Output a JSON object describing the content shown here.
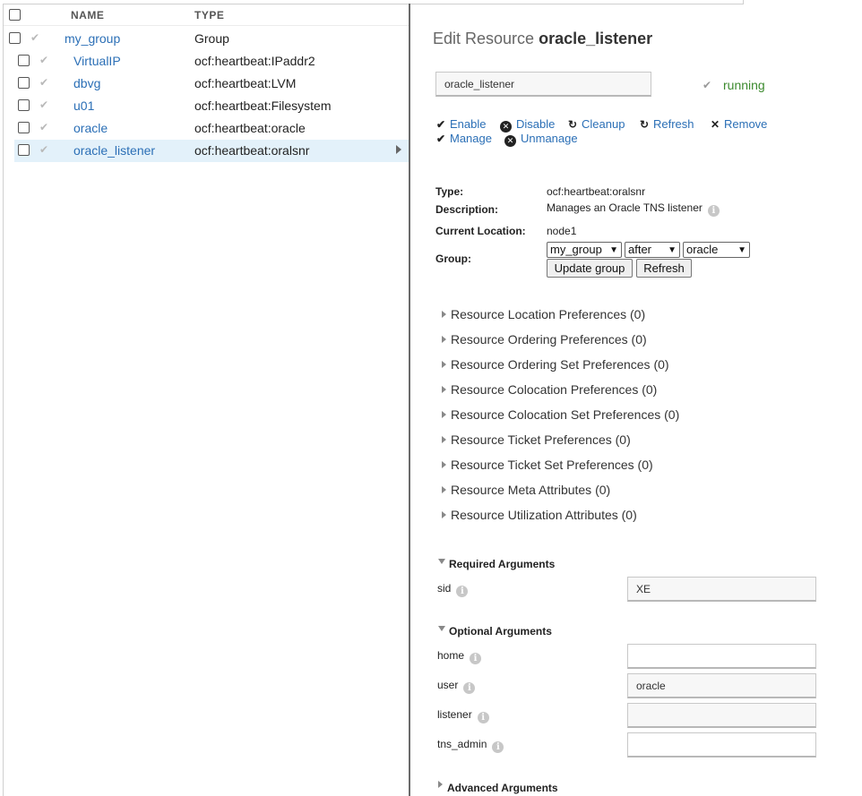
{
  "table": {
    "col_name": "NAME",
    "col_type": "TYPE",
    "rows": [
      {
        "name": "my_group",
        "type": "Group"
      },
      {
        "name": "VirtualIP",
        "type": "ocf:heartbeat:IPaddr2"
      },
      {
        "name": "dbvg",
        "type": "ocf:heartbeat:LVM"
      },
      {
        "name": "u01",
        "type": "ocf:heartbeat:Filesystem"
      },
      {
        "name": "oracle",
        "type": "ocf:heartbeat:oracle"
      },
      {
        "name": "oracle_listener",
        "type": "ocf:heartbeat:oralsnr"
      }
    ]
  },
  "edit": {
    "title_prefix": "Edit Resource",
    "title_name": "oracle_listener",
    "name_value": "oracle_listener",
    "status": "running",
    "actions": {
      "enable": "Enable",
      "disable": "Disable",
      "cleanup": "Cleanup",
      "refresh": "Refresh",
      "remove": "Remove",
      "manage": "Manage",
      "unmanage": "Unmanage"
    },
    "details": {
      "type_label": "Type:",
      "type_value": "ocf:heartbeat:oralsnr",
      "desc_label": "Description:",
      "desc_value": "Manages an Oracle TNS listener",
      "loc_label": "Current Location:",
      "loc_value": "node1",
      "group_label": "Group:",
      "group_select": "my_group",
      "position_select": "after",
      "target_select": "oracle",
      "update_group_btn": "Update group",
      "refresh_btn": "Refresh"
    },
    "preferences": [
      "Resource Location Preferences (0)",
      "Resource Ordering Preferences (0)",
      "Resource Ordering Set Preferences (0)",
      "Resource Colocation Preferences (0)",
      "Resource Colocation Set Preferences (0)",
      "Resource Ticket Preferences (0)",
      "Resource Ticket Set Preferences (0)",
      "Resource Meta Attributes (0)",
      "Resource Utilization Attributes (0)"
    ],
    "required_args": {
      "heading": "Required Arguments",
      "sid_label": "sid",
      "sid_value": "XE"
    },
    "optional_args": {
      "heading": "Optional Arguments",
      "home_label": "home",
      "home_value": "",
      "user_label": "user",
      "user_value": "oracle",
      "listener_label": "listener",
      "listener_value": "",
      "tns_admin_label": "tns_admin",
      "tns_admin_value": ""
    },
    "advanced_args": {
      "heading": "Advanced Arguments"
    }
  }
}
